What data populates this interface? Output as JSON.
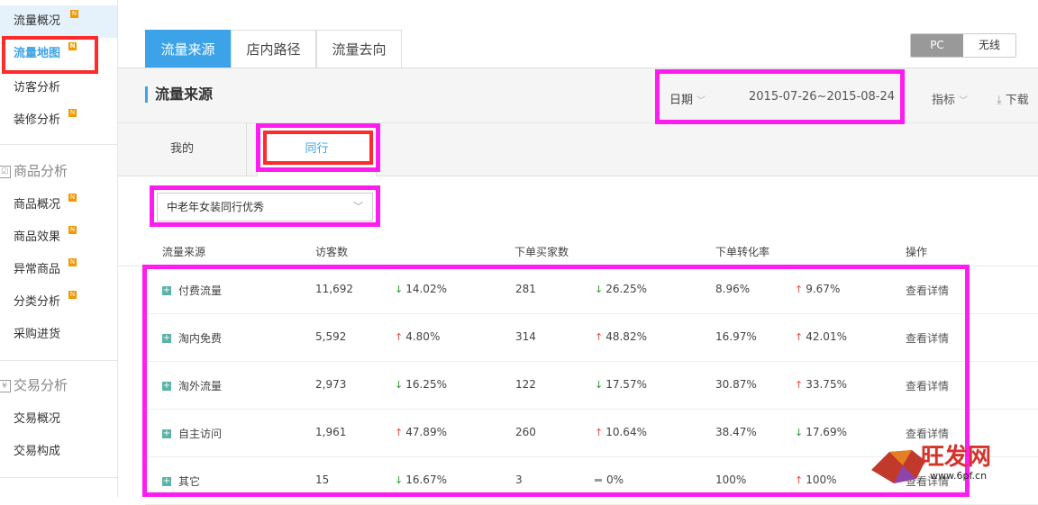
{
  "sidebar": {
    "items": [
      {
        "label": "流量概况",
        "badge": "N"
      },
      {
        "label": "流量地图",
        "badge": "N"
      },
      {
        "label": "访客分析",
        "badge": ""
      },
      {
        "label": "装修分析",
        "badge": "N"
      }
    ],
    "section_goods": "商品分析",
    "goods_items": [
      {
        "label": "商品概况",
        "badge": "N"
      },
      {
        "label": "商品效果",
        "badge": "N"
      },
      {
        "label": "异常商品",
        "badge": "N"
      },
      {
        "label": "分类分析",
        "badge": "N"
      },
      {
        "label": "采购进货",
        "badge": ""
      }
    ],
    "section_trade": "交易分析",
    "trade_items": [
      {
        "label": "交易概况"
      },
      {
        "label": "交易构成"
      }
    ]
  },
  "tabs": [
    "流量来源",
    "店内路径",
    "流量去向"
  ],
  "device_switch": {
    "pc": "PC",
    "wireless": "无线"
  },
  "header": {
    "title": "流量来源",
    "date_label": "日期",
    "date_value": "2015-07-26~2015-08-24",
    "metric_label": "指标",
    "download_label": "下载"
  },
  "subtabs": {
    "mine": "我的",
    "peer": "同行"
  },
  "select": {
    "value": "中老年女装同行优秀"
  },
  "table": {
    "headers": [
      "流量来源",
      "访客数",
      "下单买家数",
      "下单转化率",
      "操作"
    ],
    "rows": [
      {
        "source": "付费流量",
        "visitors": "11,692",
        "v_dir": "down",
        "v_change": "14.02%",
        "buyers": "281",
        "b_dir": "down",
        "b_change": "26.25%",
        "rate": "8.96%",
        "r_dir": "up",
        "r_change": "9.67%",
        "action": "查看详情"
      },
      {
        "source": "淘内免费",
        "visitors": "5,592",
        "v_dir": "up",
        "v_change": "4.80%",
        "buyers": "314",
        "b_dir": "up",
        "b_change": "48.82%",
        "rate": "16.97%",
        "r_dir": "up",
        "r_change": "42.01%",
        "action": "查看详情"
      },
      {
        "source": "淘外流量",
        "visitors": "2,973",
        "v_dir": "down",
        "v_change": "16.25%",
        "buyers": "122",
        "b_dir": "down",
        "b_change": "17.57%",
        "rate": "30.87%",
        "r_dir": "up",
        "r_change": "33.75%",
        "action": "查看详情"
      },
      {
        "source": "自主访问",
        "visitors": "1,961",
        "v_dir": "up",
        "v_change": "47.89%",
        "buyers": "260",
        "b_dir": "up",
        "b_change": "10.64%",
        "rate": "38.47%",
        "r_dir": "down",
        "r_change": "17.69%",
        "action": "查看详情"
      },
      {
        "source": "其它",
        "visitors": "15",
        "v_dir": "down",
        "v_change": "16.67%",
        "buyers": "3",
        "b_dir": "flat",
        "b_change": "0%",
        "rate": "100%",
        "r_dir": "up",
        "r_change": "100%",
        "action": "查看详情"
      }
    ]
  },
  "watermark": {
    "text": "旺发网",
    "url": "www.6pf.cn"
  },
  "colors": {
    "accent": "#3ca3e8",
    "highlight_red": "#ff2a2a",
    "highlight_magenta": "#ff1cf1",
    "up": "#e74c3c",
    "down": "#2a9d2a"
  }
}
